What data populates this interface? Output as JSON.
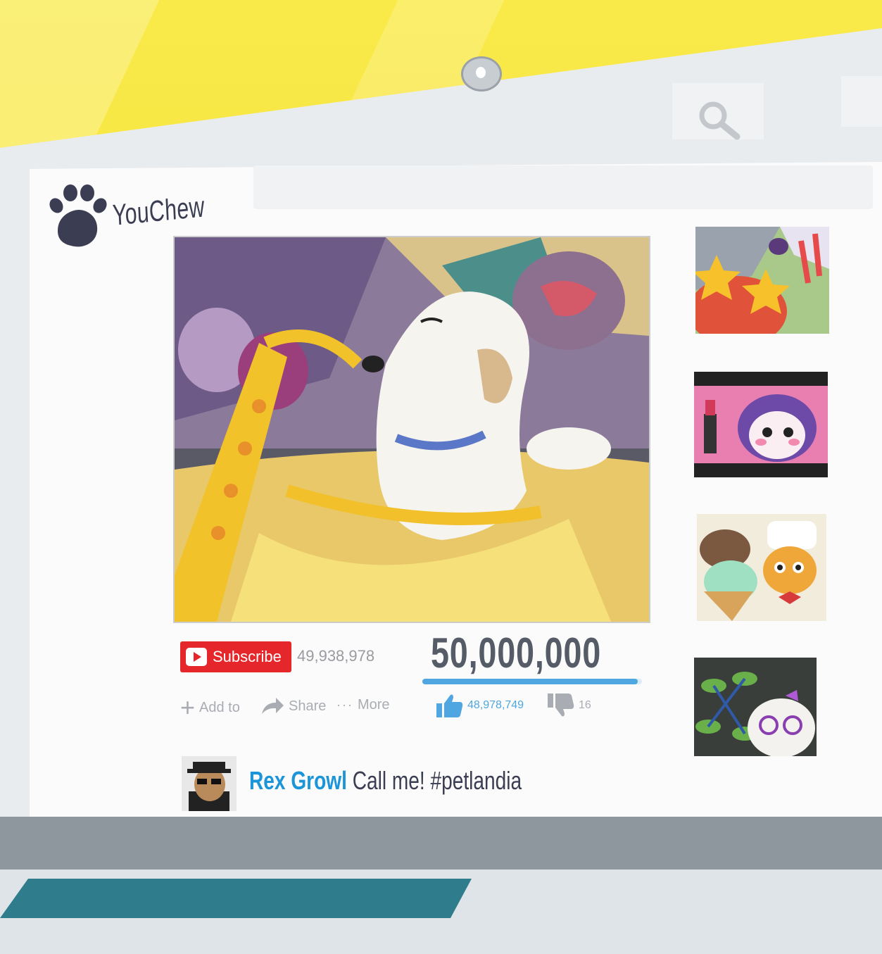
{
  "site": {
    "name": "YouChew"
  },
  "video": {
    "subscribe_label": "Subscribe",
    "subscriber_count": "49,938,978",
    "view_count": "50,000,000",
    "view_progress": 0.98,
    "actions": {
      "add_to": "Add to",
      "share": "Share",
      "more": "More"
    },
    "likes": "48,978,749",
    "dislikes": "16"
  },
  "comment": {
    "author": "Rex Growl",
    "text": "Call me! #petlandia"
  },
  "colors": {
    "accent_red": "#e5262a",
    "accent_blue": "#1c95d8",
    "like_blue": "#4fa6e0",
    "background_yellow": "#f7e23a"
  },
  "icons": [
    "search-icon",
    "paw-icon",
    "play-icon",
    "plus-icon",
    "share-icon",
    "thumbs-up-icon",
    "thumbs-down-icon"
  ]
}
